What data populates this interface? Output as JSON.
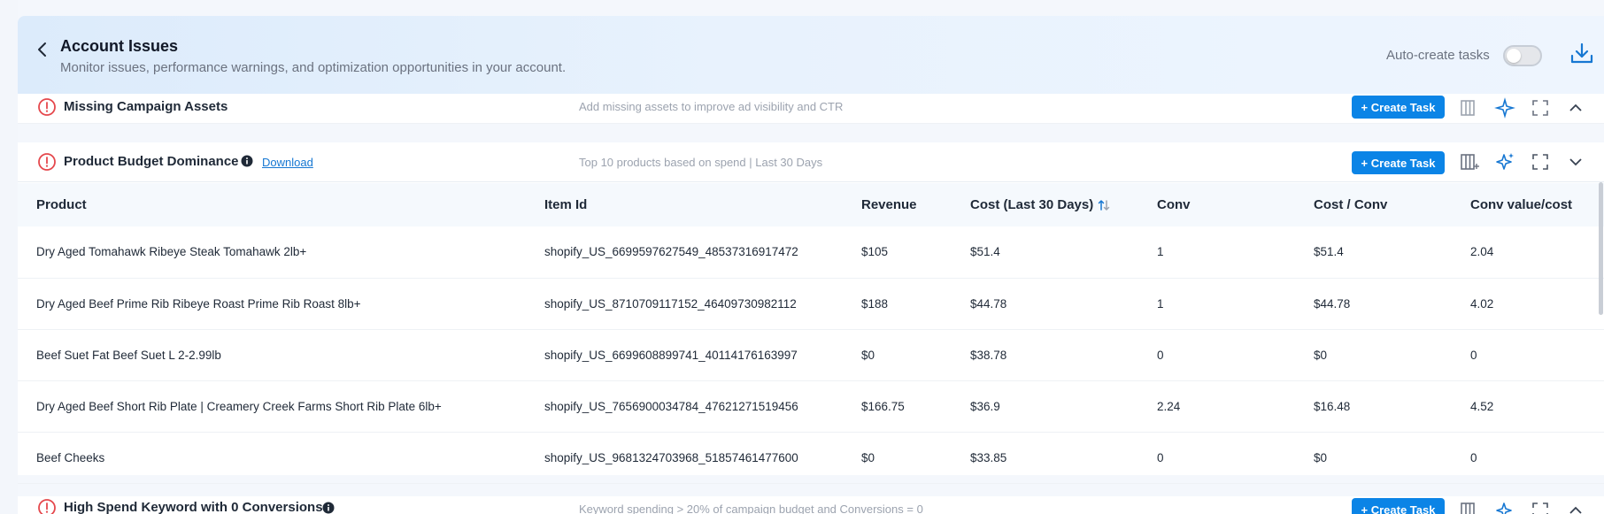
{
  "header": {
    "title": "Account Issues",
    "subtitle": "Monitor issues, performance warnings, and optimization opportunities in your account.",
    "auto_create_label": "Auto-create tasks",
    "auto_create_enabled": false
  },
  "sections": {
    "missing_assets": {
      "title": "Missing Campaign Assets",
      "description": "Add missing assets to improve ad visibility and CTR",
      "create_label": "+ Create Task"
    },
    "budget": {
      "title": "Product Budget Dominance",
      "download_label": "Download",
      "description": "Top 10 products based on spend | Last 30 Days",
      "create_label": "+ Create Task"
    },
    "keyword": {
      "title": "High Spend Keyword with 0 Conversions",
      "description": "Keyword spending > 20% of campaign budget and Conversions = 0",
      "create_label": "+ Create Task"
    }
  },
  "table": {
    "columns": [
      "Product",
      "Item Id",
      "Revenue",
      "Cost (Last 30 Days)",
      "Conv",
      "Cost / Conv",
      "Conv value/cost"
    ],
    "rows": [
      [
        "Dry Aged Tomahawk Ribeye Steak Tomahawk 2lb+",
        "shopify_US_6699597627549_48537316917472",
        "$105",
        "$51.4",
        "1",
        "$51.4",
        "2.04"
      ],
      [
        "Dry Aged Beef Prime Rib Ribeye Roast Prime Rib Roast 8lb+",
        "shopify_US_8710709117152_46409730982112",
        "$188",
        "$44.78",
        "1",
        "$44.78",
        "4.02"
      ],
      [
        "Beef Suet Fat Beef Suet L 2-2.99lb",
        "shopify_US_6699608899741_40114176163997",
        "$0",
        "$38.78",
        "0",
        "$0",
        "0"
      ],
      [
        "Dry Aged Beef Short Rib Plate | Creamery Creek Farms Short Rib Plate 6lb+",
        "shopify_US_7656900034784_47621271519456",
        "$166.75",
        "$36.9",
        "2.24",
        "$16.48",
        "4.52"
      ],
      [
        "Beef Cheeks",
        "shopify_US_9681324703968_51857461477600",
        "$0",
        "$33.85",
        "0",
        "$0",
        "0"
      ]
    ]
  },
  "colors": {
    "accent": "#0b84e6",
    "warning": "#e5484d",
    "link": "#1677d2"
  }
}
